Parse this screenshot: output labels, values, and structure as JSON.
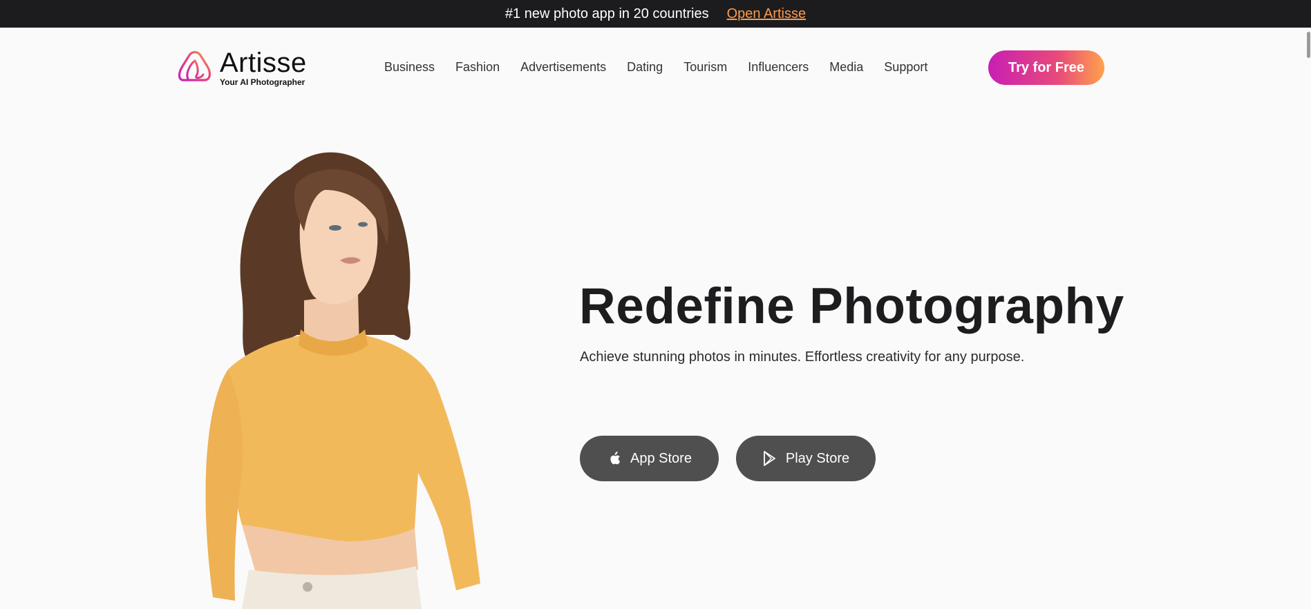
{
  "announcement": {
    "text": "#1 new photo app in 20 countries",
    "link": "Open Artisse"
  },
  "brand": {
    "name": "Artisse",
    "tagline": "Your AI Photographer",
    "logo_icon": "artisse-logo-icon"
  },
  "nav": {
    "items": [
      {
        "label": "Business"
      },
      {
        "label": "Fashion"
      },
      {
        "label": "Advertisements"
      },
      {
        "label": "Dating"
      },
      {
        "label": "Tourism"
      },
      {
        "label": "Influencers"
      },
      {
        "label": "Media"
      },
      {
        "label": "Support"
      }
    ]
  },
  "header": {
    "cta_label": "Try for Free"
  },
  "hero": {
    "title": "Redefine Photography",
    "subtitle": "Achieve stunning photos in minutes. Effortless creativity for any purpose.",
    "image": "woman-portrait-yellow-sweater",
    "buttons": {
      "app_store": {
        "label": "App Store",
        "icon": "apple-icon"
      },
      "play_store": {
        "label": "Play Store",
        "icon": "google-play-icon"
      }
    }
  },
  "colors": {
    "topbar_bg": "#1c1c1e",
    "link_accent": "#ff9a4d",
    "cta_gradient_start": "#c81fb4",
    "cta_gradient_end": "#ffa24d",
    "store_button_bg": "#4f4f4f",
    "page_bg": "#fafafa"
  }
}
